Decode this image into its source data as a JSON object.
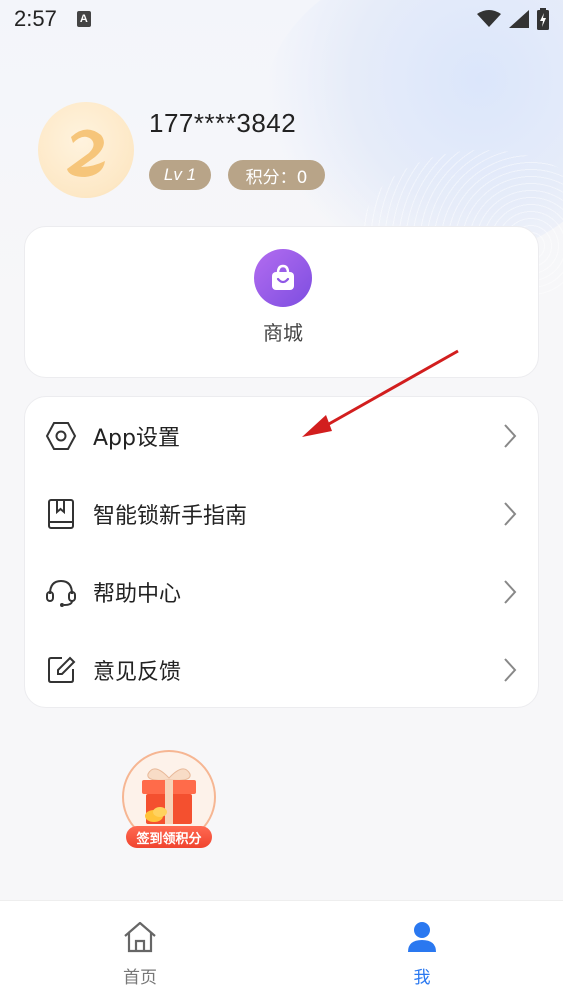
{
  "status_bar": {
    "time": "2:57",
    "notification_letter": "A"
  },
  "profile": {
    "phone": "177****3842",
    "level": "Lv 1",
    "points": "积分：0"
  },
  "shop": {
    "label": "商城"
  },
  "menu": {
    "items": [
      {
        "label": "App设置",
        "icon": "hexagon-settings-icon"
      },
      {
        "label": "智能锁新手指南",
        "icon": "book-icon"
      },
      {
        "label": "帮助中心",
        "icon": "headset-icon"
      },
      {
        "label": "意见反馈",
        "icon": "edit-icon"
      }
    ]
  },
  "gift": {
    "label": "签到领积分"
  },
  "bottom_nav": {
    "home": "首页",
    "me": "我"
  },
  "colors": {
    "accent": "#2a78f0",
    "badge": "#b8a488",
    "shop_icon": "#9a5ee8",
    "annotation_arrow": "#d21e1e"
  }
}
